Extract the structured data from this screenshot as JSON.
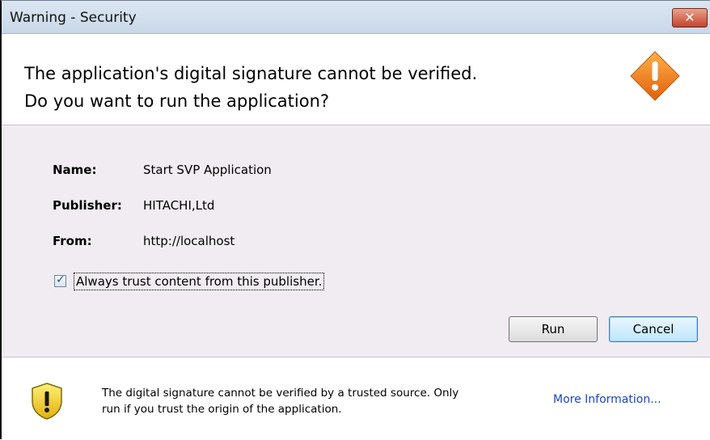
{
  "window": {
    "title": "Warning - Security",
    "close_glyph": "✕"
  },
  "header": {
    "line1": "The application's digital signature cannot be verified.",
    "line2": "Do you want to run the application?"
  },
  "details": {
    "name_label": "Name:",
    "name_value": "Start SVP Application",
    "publisher_label": "Publisher:",
    "publisher_value": "HITACHI,Ltd",
    "from_label": "From:",
    "from_value": "http://localhost"
  },
  "trust_checkbox": {
    "label": "Always trust content from this publisher.",
    "checked": true
  },
  "buttons": {
    "run": "Run",
    "cancel": "Cancel"
  },
  "footer": {
    "line1": "The digital signature cannot be verified by a trusted source.  Only",
    "line2": "run if you trust the origin of the application.",
    "more_info": "More Information..."
  },
  "icons": {
    "header_icon": "warning-diamond-icon",
    "footer_icon": "shield-warning-icon",
    "checkbox_icon": "checkmark-icon"
  },
  "colors": {
    "warning_orange": "#f07a14",
    "shield_yellow": "#f3cf2a",
    "link_blue": "#1a44cc"
  }
}
